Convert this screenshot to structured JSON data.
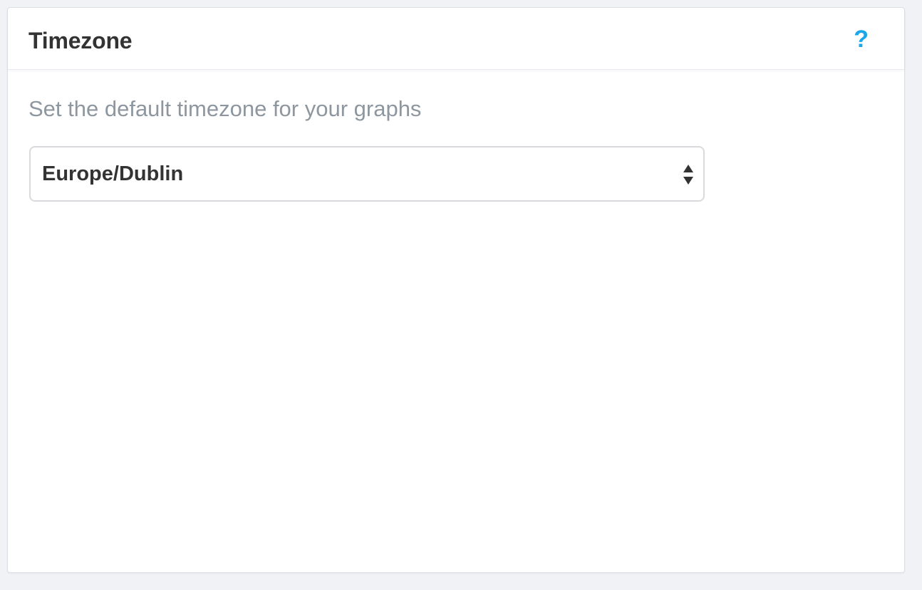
{
  "panel": {
    "title": "Timezone",
    "help_label": "?",
    "description": "Set the default timezone for your graphs",
    "timezone_select": {
      "selected_value": "Europe/Dublin",
      "options": [
        "Europe/Dublin"
      ]
    }
  },
  "icons": {
    "help": "question-mark-icon",
    "select_arrows": "up-down-arrows-icon"
  },
  "colors": {
    "background": "#f0f2f6",
    "accent": "#1ea7e8",
    "title_text": "#333333",
    "description_text": "#8e979f"
  }
}
